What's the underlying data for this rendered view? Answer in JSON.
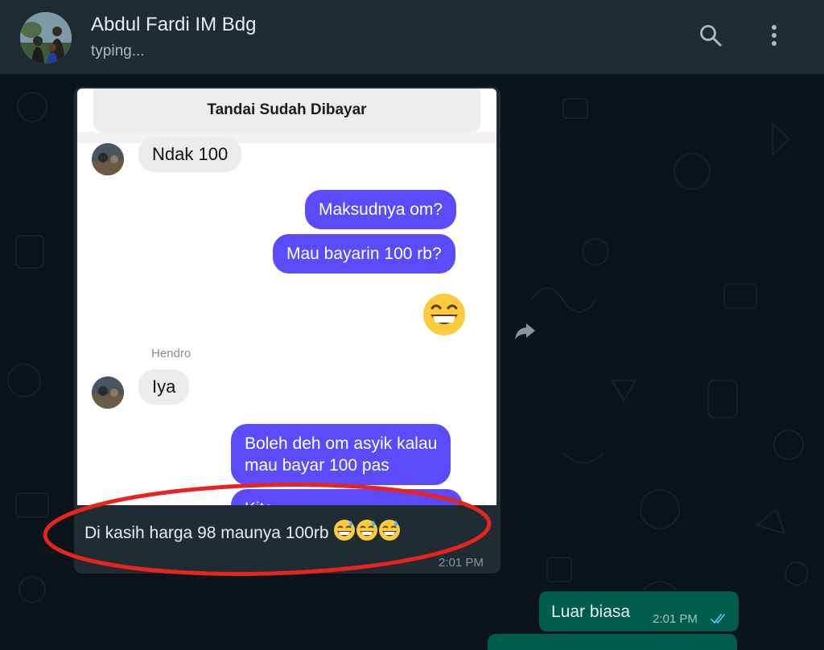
{
  "header": {
    "contact_name": "Abdul Fardi IM Bdg",
    "status": "typing...",
    "search_icon": "search-icon",
    "menu_icon": "more-vertical-icon"
  },
  "shared_screenshot": {
    "mark_paid_button": "Tandai Sudah Dibayar",
    "messages": [
      {
        "side": "in",
        "text": "Ndak 100"
      },
      {
        "side": "out",
        "text": "Maksudnya om?"
      },
      {
        "side": "out",
        "text": "Mau bayarin 100 rb?"
      },
      {
        "side": "out",
        "emoji": "grinning-face"
      },
      {
        "side": "in",
        "sender": "Hendro",
        "text": "Iya"
      },
      {
        "side": "out",
        "text_line1": "Boleh deh om asyik kalau",
        "text_line2": "mau bayar 100 pas"
      },
      {
        "side": "out",
        "text": "Kita…"
      }
    ]
  },
  "incoming": {
    "caption": "Di kasih harga 98 maunya 100rb",
    "emojis": [
      "grinning-sweat-face",
      "grinning-sweat-face",
      "grinning-sweat-face"
    ],
    "time": "2:01 PM"
  },
  "outgoing": {
    "text": "Luar biasa",
    "time": "2:01 PM",
    "status": "read-double-check-icon"
  },
  "colors": {
    "header_bg": "#1f2c34",
    "chat_bg": "#0b141a",
    "incoming_bubble": "#202c33",
    "outgoing_bubble": "#005c4b",
    "purple_bubble": "#5b4bfa",
    "annotation_red": "#e8241c",
    "read_ticks": "#53bdeb"
  }
}
